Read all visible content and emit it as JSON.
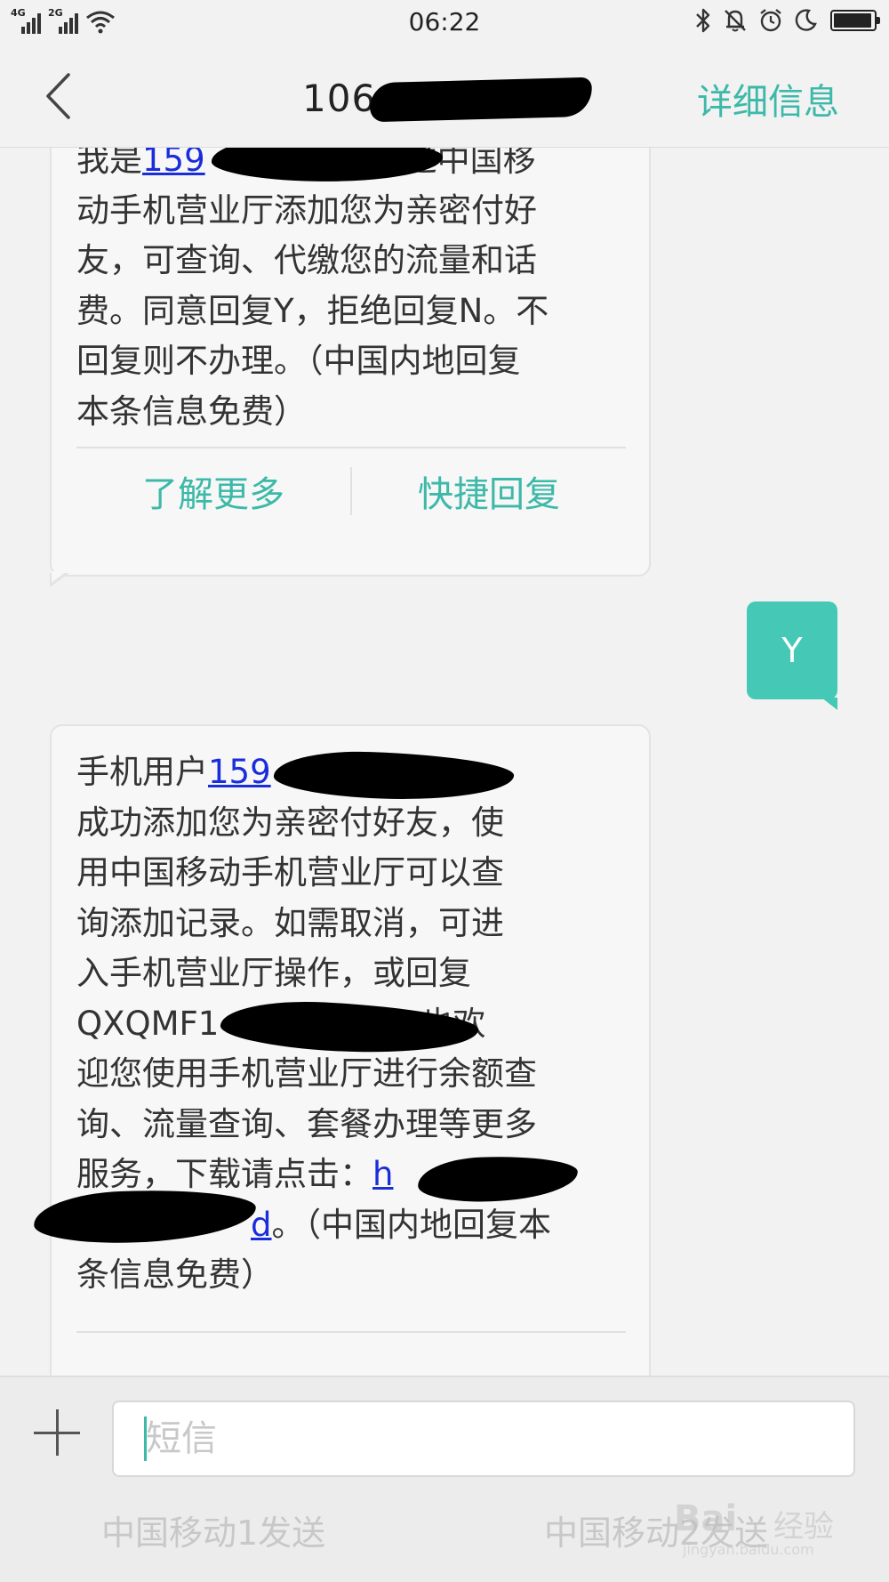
{
  "status_bar": {
    "network1": "4G",
    "network2": "2G",
    "time": "06:22",
    "battery_level": 0.95
  },
  "header": {
    "title": "106",
    "details": "详细信息"
  },
  "messages": {
    "first": {
      "line1_pre": "我是",
      "line1_link": "159",
      "line1_post": "，通过中国移",
      "rest": "动手机营业厅添加您为亲密付好\n友，可查询、代缴您的流量和话\n费。同意回复Y，拒绝回复N。不\n回复则不办理。（中国内地回复\n本条信息免费）",
      "action_more": "了解更多",
      "action_reply": "快捷回复"
    },
    "sent": {
      "text": "Y"
    },
    "second": {
      "line1_pre": "手机用户",
      "line1_link": "159",
      "line2": "成功添加您为亲密付好友，使\n用中国移动手机营业厅可以查\n询添加记录。如需取消，可进\n入手机营业厅操作，或回复",
      "line6_pre": "QXQMF1",
      "line6_post": "也欢",
      "line7": "迎您使用手机营业厅进行余额查\n询、流量查询、套餐办理等更多",
      "line9_pre": "服务，下载请点击：",
      "line9_link": "h",
      "line10_link": "d",
      "line10_post": "。（中国内地回复本",
      "line11": "条信息免费）"
    }
  },
  "input_bar": {
    "placeholder": "短信",
    "send1": "中国移动1发送",
    "send2": "中国移动2发送"
  },
  "watermark": {
    "logo": "Bai",
    "text": "经验",
    "url": "jingyan.baidu.com"
  }
}
